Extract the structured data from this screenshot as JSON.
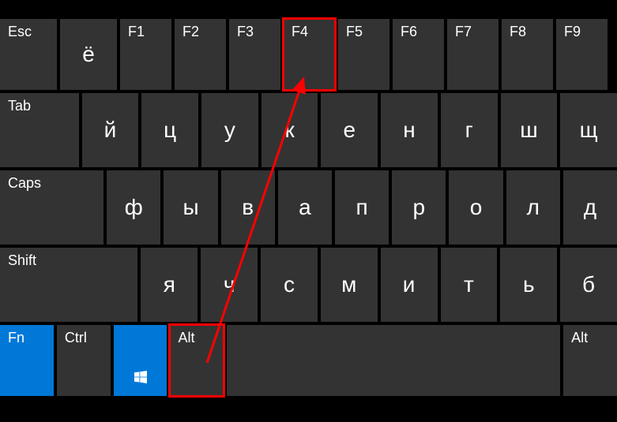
{
  "row0": {
    "esc": "Esc",
    "yo": "ё",
    "f1": "F1",
    "f2": "F2",
    "f3": "F3",
    "f4": "F4",
    "f5": "F5",
    "f6": "F6",
    "f7": "F7",
    "f8": "F8",
    "f9": "F9"
  },
  "row1": {
    "tab": "Tab",
    "k1": "й",
    "k2": "ц",
    "k3": "у",
    "k4": "к",
    "k5": "е",
    "k6": "н",
    "k7": "г",
    "k8": "ш",
    "k9": "щ"
  },
  "row2": {
    "caps": "Caps",
    "k1": "ф",
    "k2": "ы",
    "k3": "в",
    "k4": "а",
    "k5": "п",
    "k6": "р",
    "k7": "о",
    "k8": "л",
    "k9": "д"
  },
  "row3": {
    "shift": "Shift",
    "k1": "я",
    "k2": "ч",
    "k3": "с",
    "k4": "м",
    "k5": "и",
    "k6": "т",
    "k7": "ь",
    "k8": "б"
  },
  "row4": {
    "fn": "Fn",
    "ctrl": "Ctrl",
    "alt_left": "Alt",
    "alt_right": "Alt"
  },
  "annotation": {
    "highlighted_keys": [
      "F4",
      "Alt"
    ],
    "shortcut": "Alt+F4"
  }
}
